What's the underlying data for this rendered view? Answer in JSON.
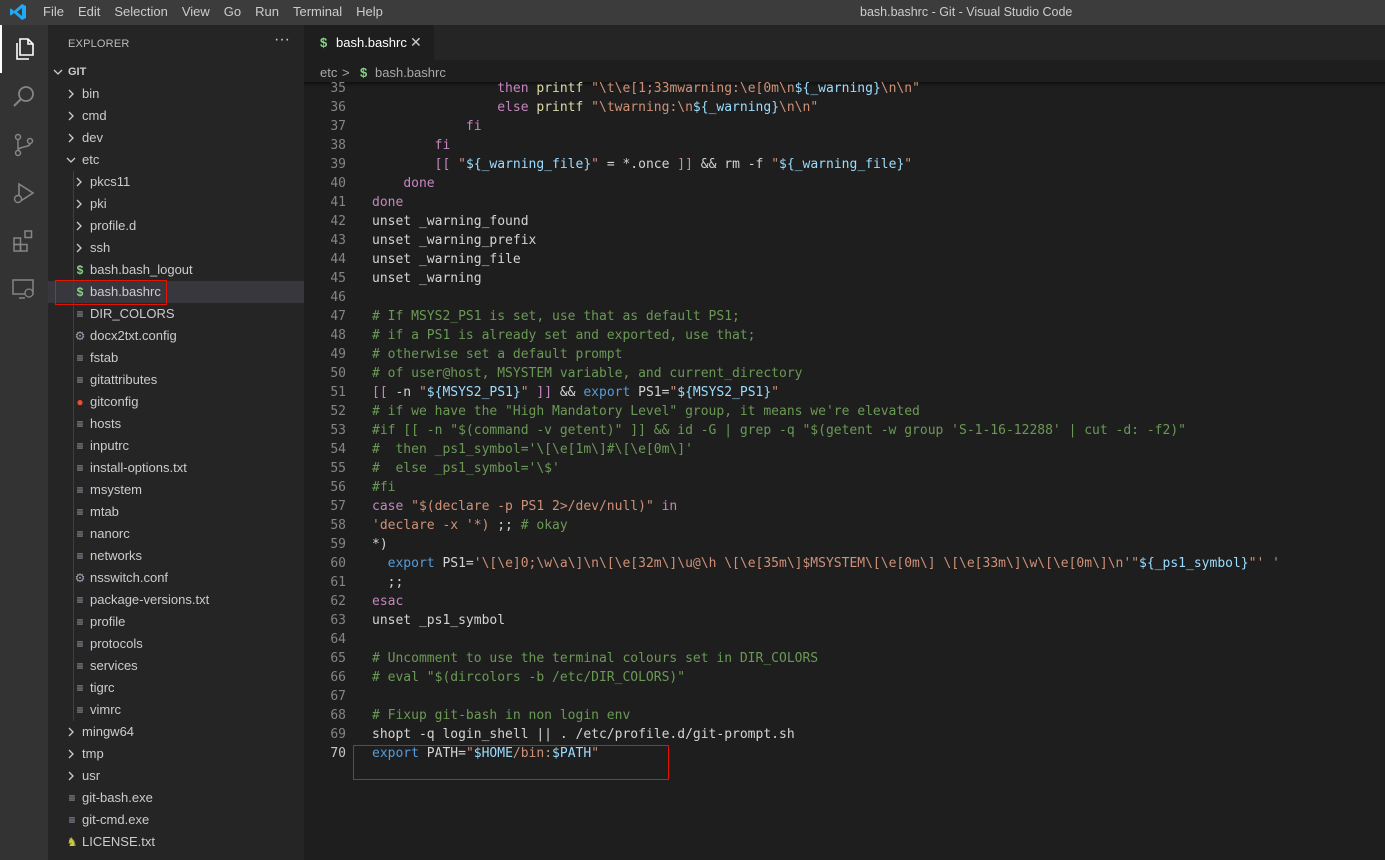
{
  "window": {
    "title": "bash.bashrc - Git - Visual Studio Code"
  },
  "menu": [
    "File",
    "Edit",
    "Selection",
    "View",
    "Go",
    "Run",
    "Terminal",
    "Help"
  ],
  "activity_bar": [
    "files-icon",
    "search-icon",
    "source-control-icon",
    "run-debug-icon",
    "extensions-icon",
    "remote-explorer-icon"
  ],
  "explorer": {
    "header": "EXPLORER",
    "more": "···",
    "root": "GIT",
    "items": [
      {
        "label": "bin",
        "type": "folder",
        "depth": 1,
        "open": false
      },
      {
        "label": "cmd",
        "type": "folder",
        "depth": 1,
        "open": false
      },
      {
        "label": "dev",
        "type": "folder",
        "depth": 1,
        "open": false
      },
      {
        "label": "etc",
        "type": "folder",
        "depth": 1,
        "open": true
      },
      {
        "label": "pkcs11",
        "type": "folder",
        "depth": 2,
        "open": false
      },
      {
        "label": "pki",
        "type": "folder",
        "depth": 2,
        "open": false
      },
      {
        "label": "profile.d",
        "type": "folder",
        "depth": 2,
        "open": false
      },
      {
        "label": "ssh",
        "type": "folder",
        "depth": 2,
        "open": false
      },
      {
        "label": "bash.bash_logout",
        "type": "shell",
        "depth": 2
      },
      {
        "label": "bash.bashrc",
        "type": "shell",
        "depth": 2,
        "selected": true
      },
      {
        "label": "DIR_COLORS",
        "type": "text",
        "depth": 2
      },
      {
        "label": "docx2txt.config",
        "type": "config",
        "depth": 2
      },
      {
        "label": "fstab",
        "type": "text",
        "depth": 2
      },
      {
        "label": "gitattributes",
        "type": "text",
        "depth": 2
      },
      {
        "label": "gitconfig",
        "type": "git",
        "depth": 2
      },
      {
        "label": "hosts",
        "type": "text",
        "depth": 2
      },
      {
        "label": "inputrc",
        "type": "text",
        "depth": 2
      },
      {
        "label": "install-options.txt",
        "type": "text",
        "depth": 2
      },
      {
        "label": "msystem",
        "type": "text",
        "depth": 2
      },
      {
        "label": "mtab",
        "type": "text",
        "depth": 2
      },
      {
        "label": "nanorc",
        "type": "text",
        "depth": 2
      },
      {
        "label": "networks",
        "type": "text",
        "depth": 2
      },
      {
        "label": "nsswitch.conf",
        "type": "config",
        "depth": 2
      },
      {
        "label": "package-versions.txt",
        "type": "text",
        "depth": 2
      },
      {
        "label": "profile",
        "type": "text",
        "depth": 2
      },
      {
        "label": "protocols",
        "type": "text",
        "depth": 2
      },
      {
        "label": "services",
        "type": "text",
        "depth": 2
      },
      {
        "label": "tigrc",
        "type": "text",
        "depth": 2
      },
      {
        "label": "vimrc",
        "type": "text",
        "depth": 2
      },
      {
        "label": "mingw64",
        "type": "folder",
        "depth": 1,
        "open": false
      },
      {
        "label": "tmp",
        "type": "folder",
        "depth": 1,
        "open": false
      },
      {
        "label": "usr",
        "type": "folder",
        "depth": 1,
        "open": false
      },
      {
        "label": "git-bash.exe",
        "type": "text",
        "depth": 1
      },
      {
        "label": "git-cmd.exe",
        "type": "text",
        "depth": 1
      },
      {
        "label": "LICENSE.txt",
        "type": "license",
        "depth": 1
      }
    ]
  },
  "tab": {
    "label": "bash.bashrc",
    "icon": "$",
    "close": "✕"
  },
  "breadcrumb": {
    "folder": "etc",
    "separator": ">",
    "icon": "$",
    "file": "bash.bashrc"
  },
  "editor": {
    "current_line": 70,
    "lines": [
      {
        "n": 35,
        "t": [
          [
            "                ",
            "p"
          ],
          [
            "then",
            "k"
          ],
          [
            " ",
            "p"
          ],
          [
            "printf",
            "f"
          ],
          [
            " ",
            "p"
          ],
          [
            "\"\\t\\e[1;33mwarning:\\e[0m\\n",
            "s"
          ],
          [
            "${_warning}",
            "v"
          ],
          [
            "\\n\\n\"",
            "s"
          ]
        ]
      },
      {
        "n": 36,
        "t": [
          [
            "                ",
            "p"
          ],
          [
            "else",
            "k"
          ],
          [
            " ",
            "p"
          ],
          [
            "printf",
            "f"
          ],
          [
            " ",
            "p"
          ],
          [
            "\"\\twarning:\\n",
            "s"
          ],
          [
            "${_warning}",
            "v"
          ],
          [
            "\\n\\n\"",
            "s"
          ]
        ]
      },
      {
        "n": 37,
        "t": [
          [
            "            ",
            "p"
          ],
          [
            "fi",
            "k"
          ]
        ]
      },
      {
        "n": 38,
        "t": [
          [
            "        ",
            "p"
          ],
          [
            "fi",
            "k"
          ]
        ]
      },
      {
        "n": 39,
        "t": [
          [
            "        ",
            "p"
          ],
          [
            "[[",
            "k"
          ],
          [
            " ",
            "p"
          ],
          [
            "\"",
            "s"
          ],
          [
            "${_warning_file}",
            "v"
          ],
          [
            "\"",
            "s"
          ],
          [
            " = *.once ",
            "p"
          ],
          [
            "]]",
            "k"
          ],
          [
            " && rm -f ",
            "p"
          ],
          [
            "\"",
            "s"
          ],
          [
            "${_warning_file}",
            "v"
          ],
          [
            "\"",
            "s"
          ]
        ]
      },
      {
        "n": 40,
        "t": [
          [
            "    ",
            "p"
          ],
          [
            "done",
            "k"
          ]
        ]
      },
      {
        "n": 41,
        "t": [
          [
            "done",
            "k"
          ]
        ]
      },
      {
        "n": 42,
        "t": [
          [
            "unset _warning_found",
            "p"
          ]
        ]
      },
      {
        "n": 43,
        "t": [
          [
            "unset _warning_prefix",
            "p"
          ]
        ]
      },
      {
        "n": 44,
        "t": [
          [
            "unset _warning_file",
            "p"
          ]
        ]
      },
      {
        "n": 45,
        "t": [
          [
            "unset _warning",
            "p"
          ]
        ]
      },
      {
        "n": 46,
        "t": []
      },
      {
        "n": 47,
        "t": [
          [
            "# If MSYS2_PS1 is set, use that as default PS1;",
            "c"
          ]
        ]
      },
      {
        "n": 48,
        "t": [
          [
            "# if a PS1 is already set and exported, use that;",
            "c"
          ]
        ]
      },
      {
        "n": 49,
        "t": [
          [
            "# otherwise set a default prompt",
            "c"
          ]
        ]
      },
      {
        "n": 50,
        "t": [
          [
            "# of user@host, MSYSTEM variable, and current_directory",
            "c"
          ]
        ]
      },
      {
        "n": 51,
        "t": [
          [
            "[[",
            "k"
          ],
          [
            " -n ",
            "p"
          ],
          [
            "\"",
            "s"
          ],
          [
            "${MSYS2_PS1}",
            "v"
          ],
          [
            "\"",
            "s"
          ],
          [
            " ",
            "p"
          ],
          [
            "]]",
            "k"
          ],
          [
            " && ",
            "p"
          ],
          [
            "export",
            "b"
          ],
          [
            " PS1=",
            "p"
          ],
          [
            "\"",
            "s"
          ],
          [
            "${MSYS2_PS1}",
            "v"
          ],
          [
            "\"",
            "s"
          ]
        ]
      },
      {
        "n": 52,
        "t": [
          [
            "# if we have the \"High Mandatory Level\" group, it means we're elevated",
            "c"
          ]
        ]
      },
      {
        "n": 53,
        "t": [
          [
            "#if [[ -n \"$(command -v getent)\" ]] && id -G | grep -q \"$(getent -w group 'S-1-16-12288' | cut -d: -f2)\"",
            "c"
          ]
        ]
      },
      {
        "n": 54,
        "t": [
          [
            "#  then _ps1_symbol='\\[\\e[1m\\]#\\[\\e[0m\\]'",
            "c"
          ]
        ]
      },
      {
        "n": 55,
        "t": [
          [
            "#  else _ps1_symbol='\\$'",
            "c"
          ]
        ]
      },
      {
        "n": 56,
        "t": [
          [
            "#fi",
            "c"
          ]
        ]
      },
      {
        "n": 57,
        "t": [
          [
            "case",
            "k"
          ],
          [
            " ",
            "p"
          ],
          [
            "\"$(declare -p PS1 2>/dev/null)\"",
            "s"
          ],
          [
            " ",
            "p"
          ],
          [
            "in",
            "k"
          ]
        ]
      },
      {
        "n": 58,
        "t": [
          [
            "'declare -x '*)",
            "s"
          ],
          [
            " ;; ",
            "p"
          ],
          [
            "# okay",
            "c"
          ]
        ]
      },
      {
        "n": 59,
        "t": [
          [
            "*)",
            "p"
          ]
        ]
      },
      {
        "n": 60,
        "t": [
          [
            "  ",
            "p"
          ],
          [
            "export",
            "b"
          ],
          [
            " PS1=",
            "p"
          ],
          [
            "'\\[\\e]0;\\w\\a\\]\\n\\[\\e[32m\\]\\u@\\h \\[\\e[35m\\]$MSYSTEM\\[\\e[0m\\] \\[\\e[33m\\]\\w\\[\\e[0m\\]\\n'",
            "s"
          ],
          [
            "\"",
            "s"
          ],
          [
            "${_ps1_symbol}",
            "v"
          ],
          [
            "\"",
            "s"
          ],
          [
            "' '",
            "s"
          ]
        ]
      },
      {
        "n": 61,
        "t": [
          [
            "  ;;",
            "p"
          ]
        ]
      },
      {
        "n": 62,
        "t": [
          [
            "esac",
            "k"
          ]
        ]
      },
      {
        "n": 63,
        "t": [
          [
            "unset _ps1_symbol",
            "p"
          ]
        ]
      },
      {
        "n": 64,
        "t": []
      },
      {
        "n": 65,
        "t": [
          [
            "# Uncomment to use the terminal colours set in DIR_COLORS",
            "c"
          ]
        ]
      },
      {
        "n": 66,
        "t": [
          [
            "# eval \"$(dircolors -b /etc/DIR_COLORS)\"",
            "c"
          ]
        ]
      },
      {
        "n": 67,
        "t": []
      },
      {
        "n": 68,
        "t": [
          [
            "# Fixup git-bash in non login env",
            "c"
          ]
        ]
      },
      {
        "n": 69,
        "t": [
          [
            "shopt -q login_shell || . /etc/profile.d/git-prompt.sh",
            "p"
          ]
        ]
      },
      {
        "n": 70,
        "t": [
          [
            "export",
            "b"
          ],
          [
            " PATH=",
            "p"
          ],
          [
            "\"",
            "s"
          ],
          [
            "$HOME",
            "v"
          ],
          [
            "/bin:",
            "s"
          ],
          [
            "$PATH",
            "v"
          ],
          [
            "\"",
            "s"
          ]
        ]
      }
    ]
  },
  "colors": {
    "accent": "#007acc",
    "highlight_box": "#e51400",
    "shell_icon": "#89d185"
  }
}
